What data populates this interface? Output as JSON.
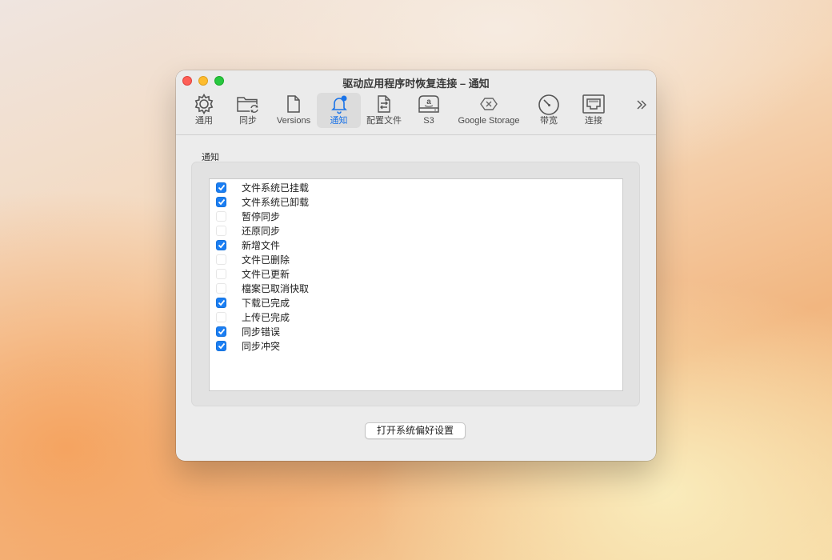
{
  "window": {
    "title": "驱动应用程序时恢复连接 – 通知"
  },
  "toolbar": {
    "items": [
      {
        "label": "通用",
        "icon": "gear-icon"
      },
      {
        "label": "同步",
        "icon": "folder-sync-icon"
      },
      {
        "label": "Versions",
        "icon": "document-icon"
      },
      {
        "label": "通知",
        "icon": "bell-badge-icon",
        "active": true
      },
      {
        "label": "配置文件",
        "icon": "profile-file-icon"
      },
      {
        "label": "S3",
        "icon": "amazon-drive-icon"
      },
      {
        "label": "Google Storage",
        "icon": "google-cloud-icon"
      },
      {
        "label": "带宽",
        "icon": "speedometer-icon"
      },
      {
        "label": "连接",
        "icon": "ethernet-port-icon"
      }
    ],
    "overflow_icon": "double-chevron-right-icon",
    "accent_color": "#1a73e8"
  },
  "notifications": {
    "group_label": "通知",
    "items": [
      {
        "label": "文件系统已挂载",
        "checked": true
      },
      {
        "label": "文件系统已卸载",
        "checked": true
      },
      {
        "label": "暂停同步",
        "checked": false
      },
      {
        "label": "还原同步",
        "checked": false
      },
      {
        "label": "新增文件",
        "checked": true
      },
      {
        "label": "文件已删除",
        "checked": false
      },
      {
        "label": "文件已更新",
        "checked": false
      },
      {
        "label": "檔案已取消快取",
        "checked": false
      },
      {
        "label": "下载已完成",
        "checked": true
      },
      {
        "label": "上传已完成",
        "checked": false
      },
      {
        "label": "同步错误",
        "checked": true
      },
      {
        "label": "同步冲突",
        "checked": true
      }
    ],
    "checkbox_color": "#1a7ef3"
  },
  "footer": {
    "button_label": "打开系统偏好设置"
  }
}
